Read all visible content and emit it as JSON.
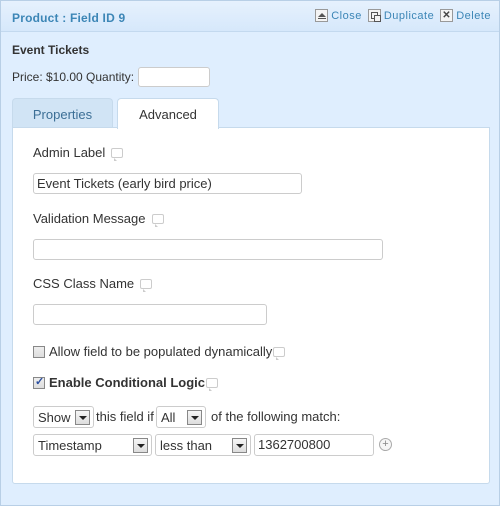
{
  "header": {
    "title": "Product : Field ID 9",
    "actions": {
      "close": "Close",
      "duplicate": "Duplicate",
      "delete": "Delete"
    }
  },
  "preview": {
    "field_label": "Event Tickets",
    "price_text": "Price: $10.00 Quantity:",
    "quantity_value": ""
  },
  "tabs": [
    {
      "label": "Properties",
      "active": false
    },
    {
      "label": "Advanced",
      "active": true
    }
  ],
  "advanced": {
    "admin_label": {
      "label": "Admin Label",
      "value": "Event Tickets (early bird price)"
    },
    "validation_message": {
      "label": "Validation Message",
      "value": ""
    },
    "css_class": {
      "label": "CSS Class Name",
      "value": ""
    },
    "populate_dynamic": {
      "label": "Allow field to be populated dynamically",
      "checked": false
    },
    "conditional_logic": {
      "label": "Enable Conditional Logic",
      "checked": true
    },
    "logic": {
      "action": "Show",
      "text_mid": "this field if",
      "match": "All",
      "text_end": "of the following match:",
      "rule": {
        "field": "Timestamp",
        "operator": "less than",
        "value": "1362700800"
      }
    }
  }
}
